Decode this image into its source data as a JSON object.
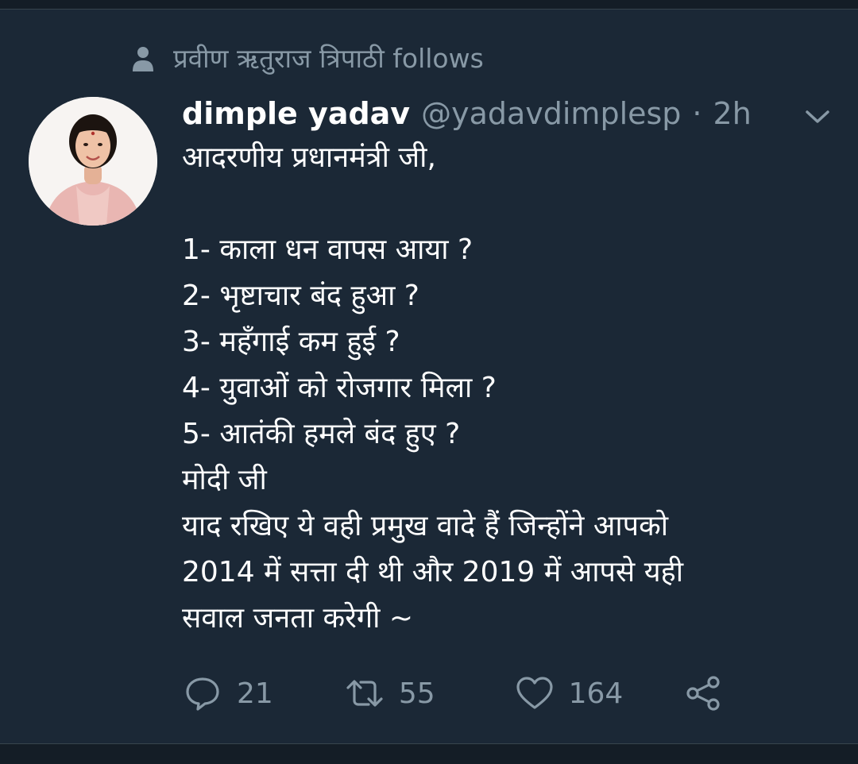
{
  "social_context": {
    "text": "प्रवीण ऋतुराज त्रिपाठी follows",
    "icon": "person-icon"
  },
  "tweet": {
    "author_name": "dimple yadav",
    "handle": "@yadavdimplesp",
    "separator": "·",
    "time": "2h",
    "lines": [
      "आदरणीय प्रधानमंत्री जी,",
      "",
      "1- काला धन वापस आया ?",
      "2- भृष्टाचार बंद हुआ ?",
      "3- महँगाई कम हुई ?",
      "4- युवाओं को रोजगार मिला ?",
      "5- आतंकी हमले बंद हुए ?",
      "मोदी जी",
      "याद रखिए ये वही प्रमुख वादे हैं जिन्होंने आपको",
      "2014 में सत्ता दी थी और 2019 में आपसे यही",
      "सवाल जनता करेगी ~"
    ]
  },
  "actions": {
    "reply_count": "21",
    "retweet_count": "55",
    "like_count": "164"
  },
  "colors": {
    "background": "#1b2836",
    "secondary_text": "#8899a6",
    "primary_text": "#ffffff"
  }
}
